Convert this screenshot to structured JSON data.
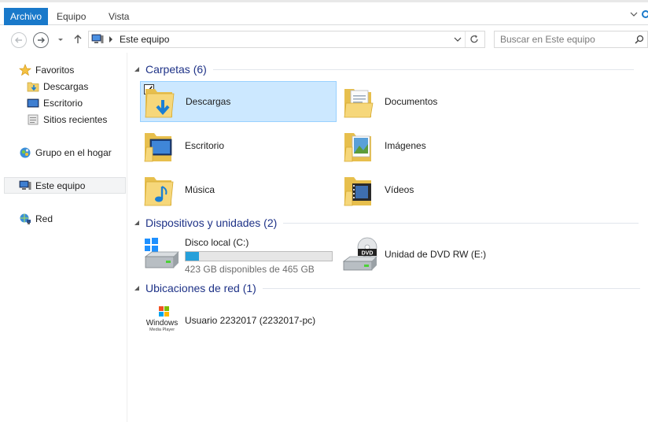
{
  "ribbon": {
    "tabs": [
      "Archivo",
      "Equipo",
      "Vista"
    ]
  },
  "address": {
    "path": "Este equipo",
    "search_placeholder": "Buscar en Este equipo"
  },
  "nav": {
    "favorites": "Favoritos",
    "downloads": "Descargas",
    "desktop": "Escritorio",
    "recent": "Sitios recientes",
    "homegroup": "Grupo en el hogar",
    "thispc": "Este equipo",
    "network": "Red"
  },
  "groups": {
    "folders": "Carpetas (6)",
    "devices": "Dispositivos y unidades (2)",
    "network": "Ubicaciones de red (1)"
  },
  "folders": [
    {
      "label": "Descargas",
      "icon": "downloads-folder-icon",
      "selected": true
    },
    {
      "label": "Documentos",
      "icon": "documents-folder-icon",
      "selected": false
    },
    {
      "label": "Escritorio",
      "icon": "desktop-folder-icon",
      "selected": false
    },
    {
      "label": "Imágenes",
      "icon": "pictures-folder-icon",
      "selected": false
    },
    {
      "label": "Música",
      "icon": "music-folder-icon",
      "selected": false
    },
    {
      "label": "Vídeos",
      "icon": "videos-folder-icon",
      "selected": false
    }
  ],
  "drives": [
    {
      "label": "Disco local (C:)",
      "space": "423 GB disponibles de 465 GB",
      "used_fraction": 0.09,
      "icon": "hard-drive-icon"
    },
    {
      "label": "Unidad de DVD RW (E:)",
      "icon": "dvd-drive-icon"
    }
  ],
  "network_locations": [
    {
      "label": "Usuario 2232017 (2232017-pc)",
      "icon": "media-server-icon",
      "logo_text": "Windows Media Player"
    }
  ],
  "colors": {
    "accent": "#1979ca",
    "selection": "#cce8ff",
    "group_title": "#1e3287",
    "progress": "#26a0da"
  }
}
